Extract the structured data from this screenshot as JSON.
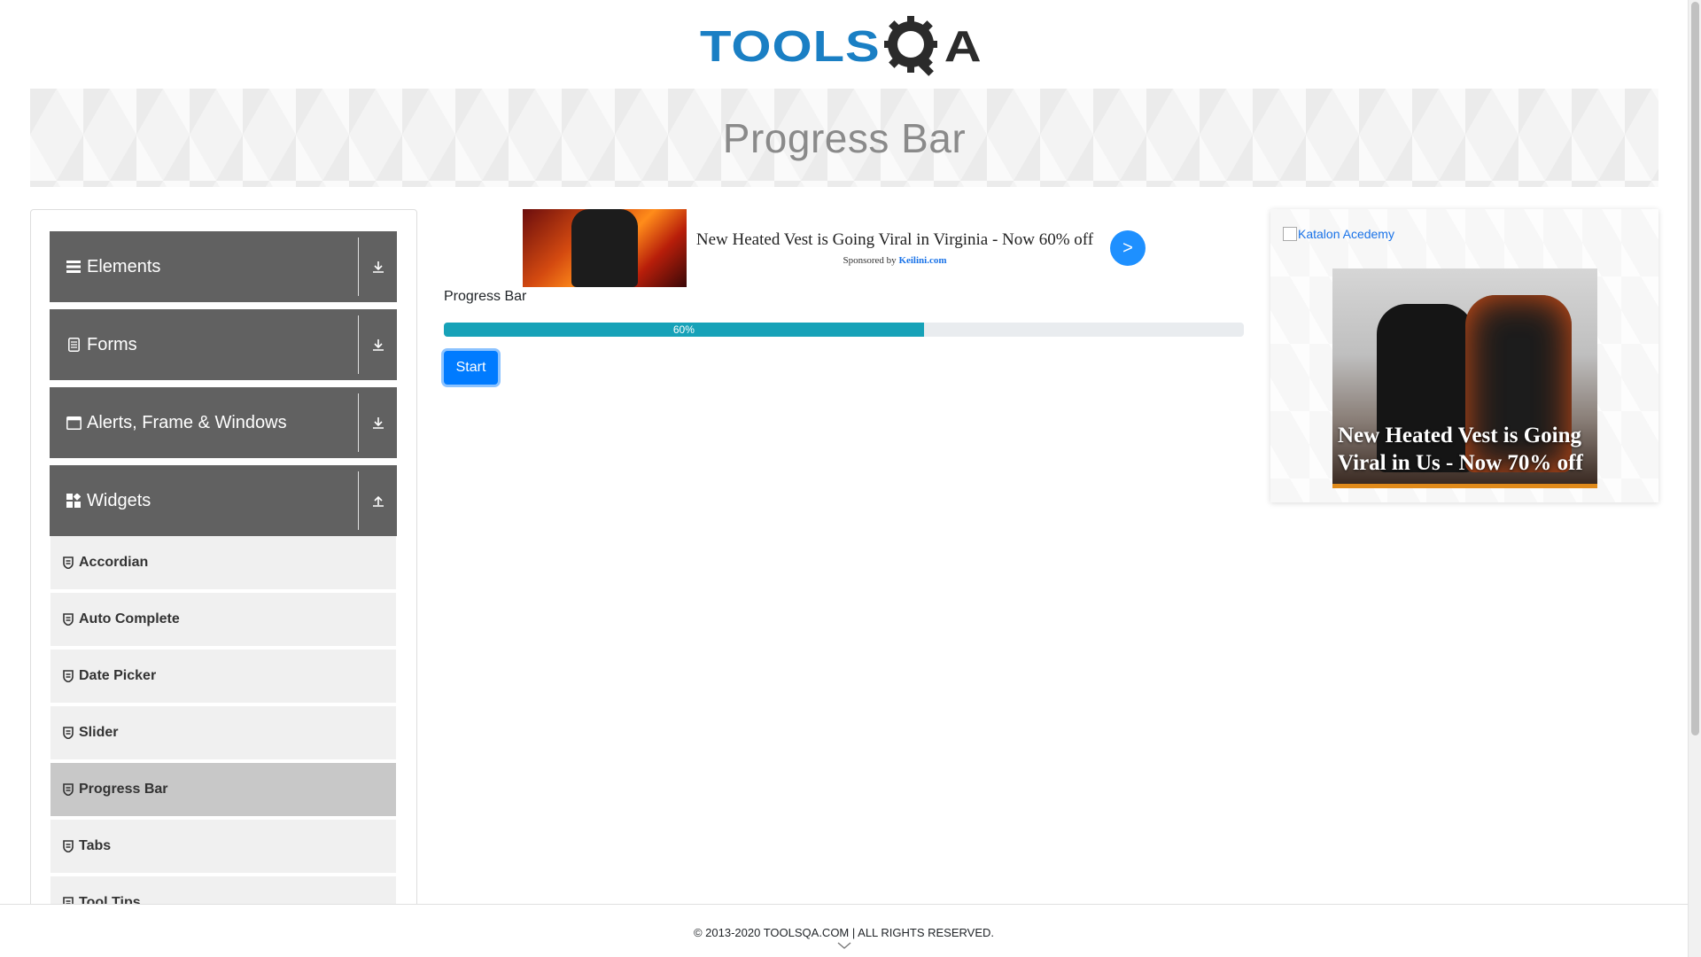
{
  "header": {
    "logo_text_left": "TOOLS",
    "logo_text_right": "QA"
  },
  "banner": {
    "title": "Progress Bar"
  },
  "sidebar": {
    "groups": [
      {
        "label": "Elements",
        "icon": "hamburger-icon",
        "toggle_icon": "expand-down-icon"
      },
      {
        "label": "Forms",
        "icon": "document-icon",
        "toggle_icon": "expand-down-icon"
      },
      {
        "label": "Alerts, Frame & Windows",
        "icon": "window-icon",
        "toggle_icon": "expand-down-icon"
      },
      {
        "label": "Widgets",
        "icon": "widgets-icon",
        "toggle_icon": "collapse-up-icon"
      }
    ],
    "items": [
      {
        "label": "Accordian"
      },
      {
        "label": "Auto Complete"
      },
      {
        "label": "Date Picker"
      },
      {
        "label": "Slider"
      },
      {
        "label": "Progress Bar",
        "active": true
      },
      {
        "label": "Tabs"
      },
      {
        "label": "Tool Tips"
      }
    ]
  },
  "ad_top": {
    "headline": "New Heated Vest is Going Viral in Virginia - Now 60% off",
    "sponsored_by": "Sponsored by",
    "sponsor": "Keilini.com",
    "button": ">"
  },
  "main": {
    "progress_label": "Progress Bar",
    "progress_value": 60,
    "progress_text": "60%",
    "progress_color": "#17a2b8",
    "start_button": "Start"
  },
  "ad_right": {
    "alt_link": "Katalon Acedemy",
    "caption": "New Heated Vest is Going Viral in Us - Now 70% off"
  },
  "footer": {
    "copyright": "© 2013-2020 TOOLSQA.COM | ALL RIGHTS RESERVED."
  }
}
